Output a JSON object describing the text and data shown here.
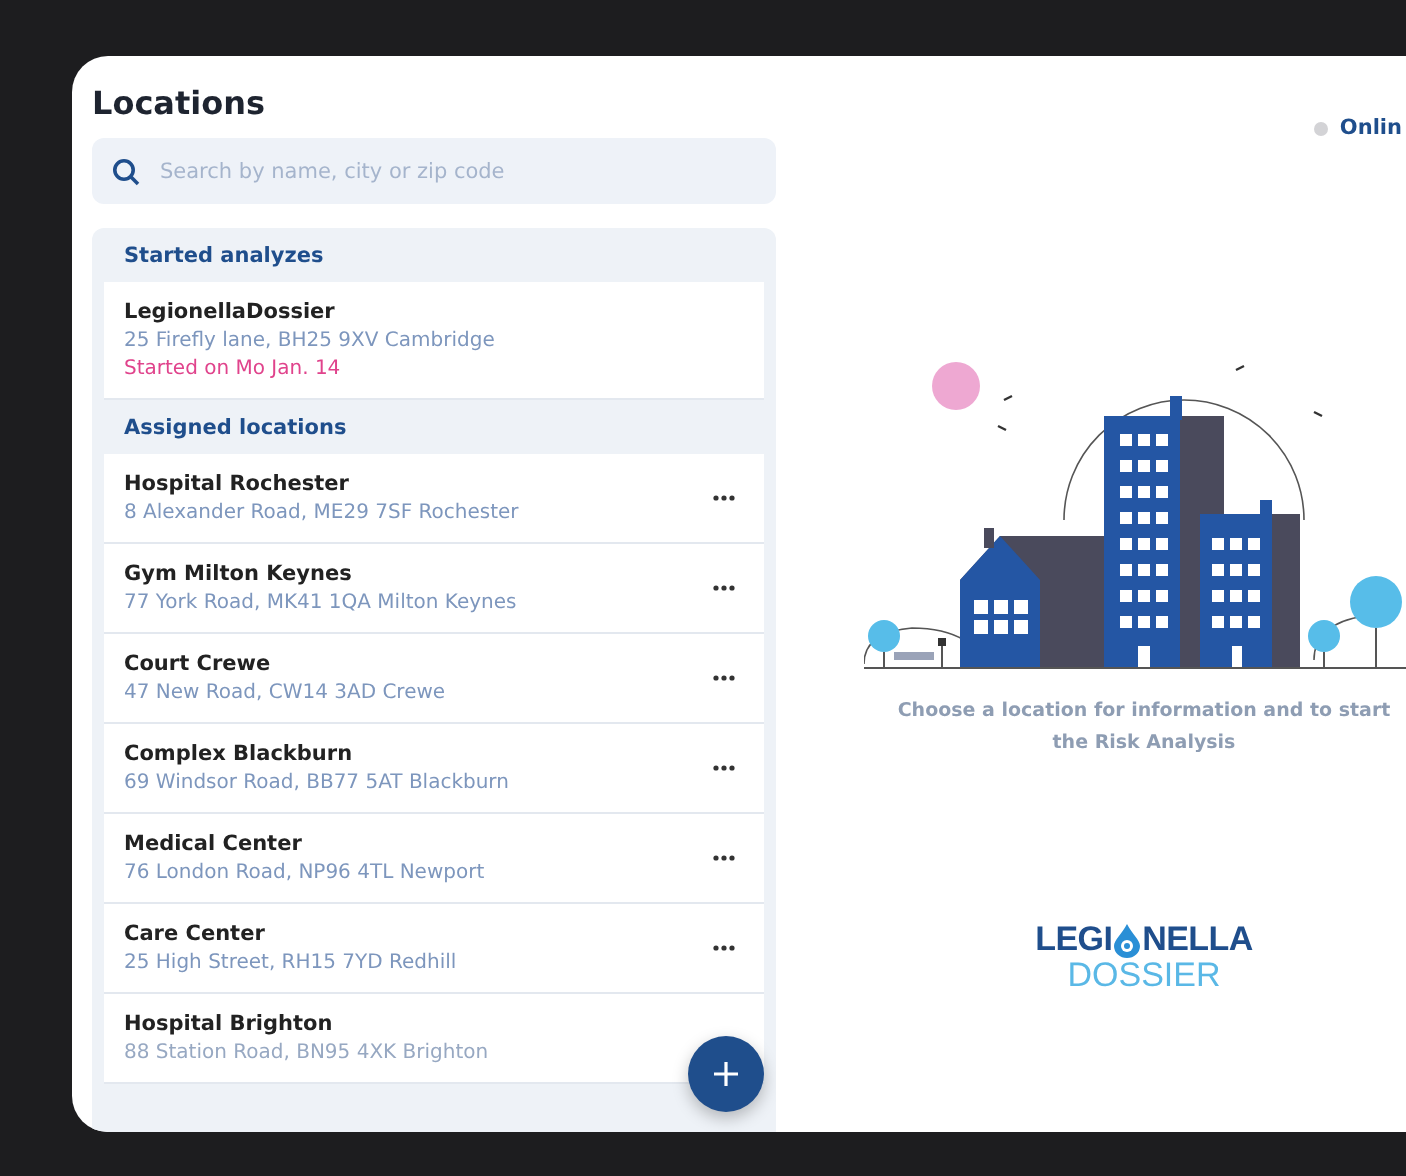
{
  "title": "Locations",
  "status": {
    "label": "Onlin"
  },
  "search": {
    "placeholder": "Search by name, city or zip code"
  },
  "sections": [
    {
      "heading": "Started analyzes",
      "items": [
        {
          "name": "LegionellaDossier",
          "address": "25 Firefly lane, BH25 9XV Cambridge",
          "note": "Started on Mo Jan. 14",
          "has_menu": false
        }
      ]
    },
    {
      "heading": "Assigned locations",
      "items": [
        {
          "name": "Hospital Rochester",
          "address": "8 Alexander Road, ME29 7SF Rochester",
          "has_menu": true
        },
        {
          "name": "Gym Milton Keynes",
          "address": "77 York Road, MK41 1QA Milton Keynes",
          "has_menu": true
        },
        {
          "name": "Court Crewe",
          "address": "47 New Road, CW14 3AD Crewe",
          "has_menu": true
        },
        {
          "name": "Complex Blackburn",
          "address": "69 Windsor Road, BB77 5AT Blackburn",
          "has_menu": true
        },
        {
          "name": "Medical Center",
          "address": "76 London Road, NP96 4TL Newport",
          "has_menu": true
        },
        {
          "name": "Care Center",
          "address": "25 High Street, RH15 7YD Redhill",
          "has_menu": true
        },
        {
          "name": "Hospital Brighton",
          "address": "88 Station Road, BN95 4XK Brighton",
          "has_menu": false
        }
      ]
    }
  ],
  "empty_message": "Choose a location for information and to start the Risk Analysis",
  "logo": {
    "word_start": "LEGI",
    "word_end": "NELLA",
    "subtitle": "DOSSIER"
  }
}
